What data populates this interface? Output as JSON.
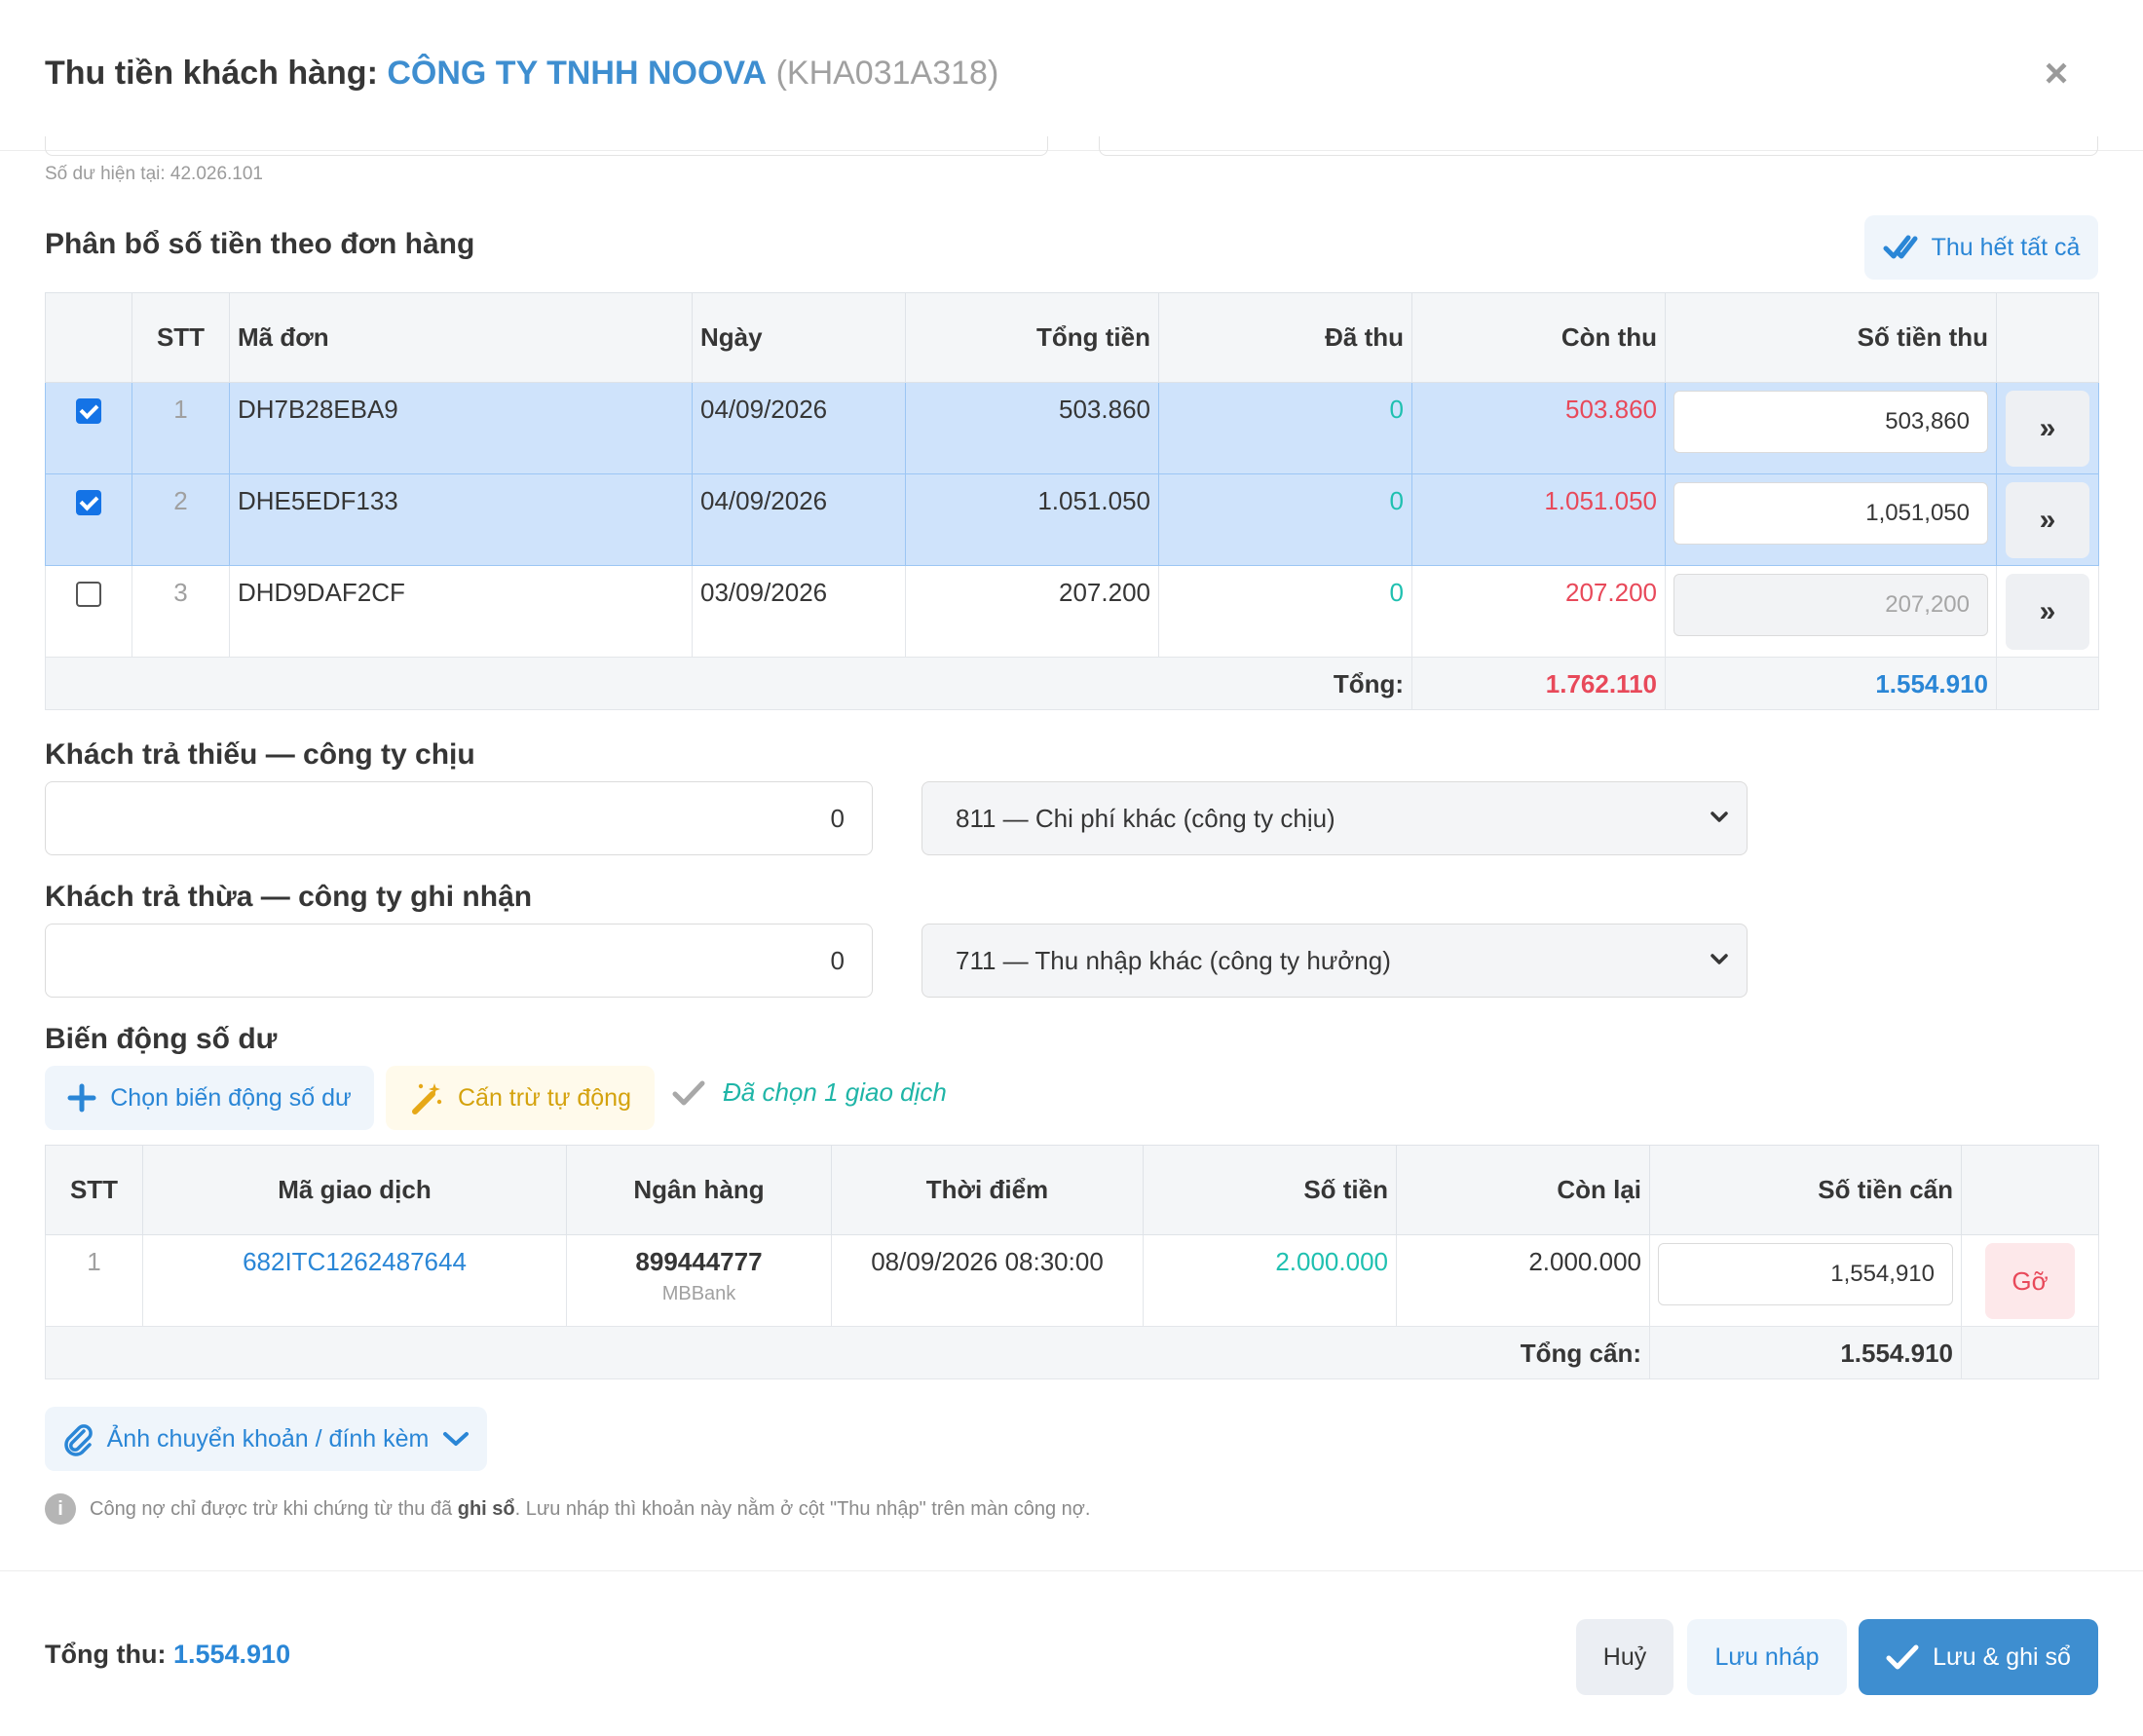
{
  "modal": {
    "title_label": "Thu tiền khách hàng:",
    "customer_name": "CÔNG TY TNHH NOOVA",
    "customer_code": "(KHA031A318)",
    "close_glyph": "×"
  },
  "balance_note": "Số dư hiện tại: 42.026.101",
  "allocation": {
    "title": "Phân bổ số tiền theo đơn hàng",
    "collect_all_label": "Thu hết tất cả",
    "headers": [
      "STT",
      "Mã đơn",
      "Ngày",
      "Tổng tiền",
      "Đã thu",
      "Còn thu",
      "Số tiền thu"
    ],
    "rows": [
      {
        "checked": true,
        "stt": "1",
        "code": "DH7B28EBA9",
        "date": "04/09/2026",
        "total": "503.860",
        "paid": "0",
        "remaining": "503.860",
        "amount": "503,860",
        "disabled": false
      },
      {
        "checked": true,
        "stt": "2",
        "code": "DHE5EDF133",
        "date": "04/09/2026",
        "total": "1.051.050",
        "paid": "0",
        "remaining": "1.051.050",
        "amount": "1,051,050",
        "disabled": false
      },
      {
        "checked": false,
        "stt": "3",
        "code": "DHD9DAF2CF",
        "date": "03/09/2026",
        "total": "207.200",
        "paid": "0",
        "remaining": "207.200",
        "amount": "207,200",
        "disabled": true
      }
    ],
    "fill_glyph": "»",
    "footer_label": "Tổng:",
    "footer_remaining": "1.762.110",
    "footer_amount": "1.554.910"
  },
  "underpay": {
    "title": "Khách trả thiếu — công ty chịu",
    "value": "0",
    "account": "811 — Chi phí khác (công ty chịu)"
  },
  "overpay": {
    "title": "Khách trả thừa — công ty ghi nhận",
    "value": "0",
    "account": "711 — Thu nhập khác (công ty hưởng)"
  },
  "balance": {
    "title": "Biến động số dư",
    "choose_label": "Chọn biến động số dư",
    "auto_label": "Cấn trừ tự động",
    "selected_note": "Đã chọn 1 giao dịch",
    "headers": [
      "STT",
      "Mã giao dịch",
      "Ngân hàng",
      "Thời điểm",
      "Số tiền",
      "Còn lại",
      "Số tiền cấn"
    ],
    "rows": [
      {
        "stt": "1",
        "txn": "682ITC1262487644",
        "account_no": "899444777",
        "bank": "MBBank",
        "time": "08/09/2026 08:30:00",
        "amount": "2.000.000",
        "remaining": "2.000.000",
        "offset": "1,554,910",
        "remove_label": "Gỡ"
      }
    ],
    "footer_label": "Tổng cấn:",
    "footer_value": "1.554.910"
  },
  "attachment_label": "Ảnh chuyển khoản / đính kèm",
  "note": {
    "part1": "Công nợ chỉ được trừ khi chứng từ thu đã ",
    "bold": "ghi sổ",
    "part2": ". Lưu nháp thì khoản này nằm ở cột \"Thu nhập\" trên màn công nợ."
  },
  "footer": {
    "total_label": "Tổng thu:",
    "total_value": "1.554.910",
    "cancel_label": "Huỷ",
    "draft_label": "Lưu nháp",
    "save_label": "Lưu & ghi sổ"
  },
  "colors": {
    "primary": "#3e8ed0",
    "danger": "#e8495a",
    "success_teal": "#1fc0b0",
    "selected_row": "#cfe3fb"
  }
}
